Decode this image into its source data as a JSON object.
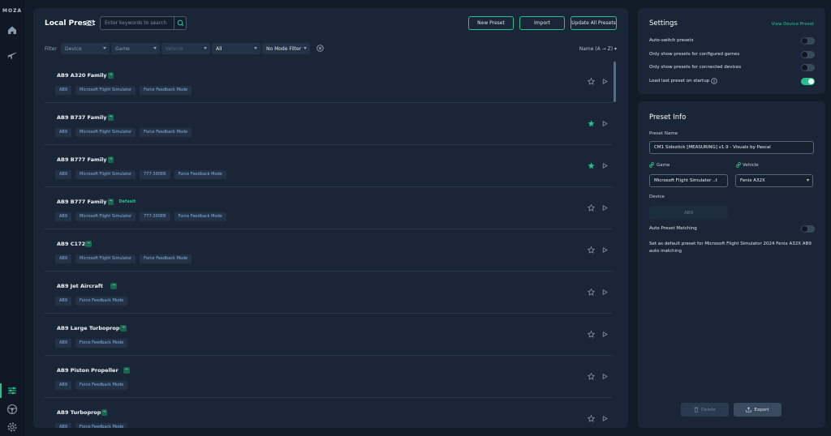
{
  "app": {
    "logo": "MOZA"
  },
  "local_preset": {
    "title": "Local Preset",
    "search_placeholder": "Enter keywords to search",
    "new_preset": "New Preset",
    "import": "Import",
    "update_all": "Update All Presets",
    "filter_label": "Filter",
    "filters": {
      "device": "Device",
      "game": "Game",
      "vehicle": "Vehicle",
      "all": "All",
      "mode": "No Mode Filter"
    },
    "sort": "Name (A → Z)",
    "rows": [
      {
        "name": "AB9 A320 Family",
        "version": "→",
        "default": "",
        "starred": false,
        "tags": [
          "AB9",
          "Microsoft Flight Simulator",
          "Force Feedback Mode"
        ]
      },
      {
        "name": "AB9 B737 Family",
        "version": "→",
        "default": "",
        "starred": true,
        "tags": [
          "AB9",
          "Microsoft Flight Simulator",
          "Force Feedback Mode"
        ]
      },
      {
        "name": "AB9 B777 Family",
        "version": "→",
        "default": "",
        "starred": true,
        "tags": [
          "AB9",
          "Microsoft Flight Simulator",
          "777-300ER",
          "Force Feedback Mode"
        ]
      },
      {
        "name": "AB9 B777 Family",
        "version": "→",
        "default": "Default",
        "starred": false,
        "tags": [
          "AB9",
          "Microsoft Flight Simulator",
          "777-300ER",
          "Force Feedback Mode"
        ]
      },
      {
        "name": "AB9 C172",
        "version": "→",
        "default": "",
        "starred": false,
        "tags": [
          "AB9",
          "Microsoft Flight Simulator",
          "Force Feedback Mode"
        ]
      },
      {
        "name": "AB9 Jet Aircraft",
        "version": "→",
        "default": "",
        "starred": false,
        "tags": [
          "AB9",
          "Force Feedback Mode"
        ]
      },
      {
        "name": "AB9 Large Turboprop",
        "version": "→",
        "default": "",
        "starred": false,
        "tags": [
          "AB9",
          "Force Feedback Mode"
        ]
      },
      {
        "name": "AB9 Piston Propeller",
        "version": "→",
        "default": "",
        "starred": false,
        "tags": [
          "AB9",
          "Force Feedback Mode"
        ]
      },
      {
        "name": "AB9 Turboprop",
        "version": "→",
        "default": "",
        "starred": false,
        "tags": [
          "AB9",
          "Force Feedback Mode"
        ]
      }
    ]
  },
  "settings": {
    "title": "Settings",
    "view_device_preset": "View Device Preset",
    "items": [
      {
        "label": "Auto-switch presets",
        "on": false
      },
      {
        "label": "Only show presets for configured games",
        "on": false
      },
      {
        "label": "Only show presets for connected devices",
        "on": false
      },
      {
        "label": "Load last preset on startup",
        "on": true
      }
    ]
  },
  "preset_info": {
    "title": "Preset Info",
    "name_label": "Preset Name",
    "name_value": "CM1 Sidestick [MEASURING] v1.9 - Visuals by Pascal",
    "game_label": "Game",
    "game_value": "Microsoft Flight Simulator ..t",
    "vehicle_label": "Vehicle",
    "vehicle_value": "Fenix A32X",
    "device_label": "Device",
    "device_value": "AB9",
    "auto_match_label": "Auto Preset Matching",
    "auto_match_on": false,
    "description": "Set as default preset for  Microsoft Flight Simulator 2024 Fenix A32X AB9 auto matching",
    "delete": "Delete",
    "export": "Export"
  },
  "colors": {
    "accent": "#27c08c",
    "panel": "#1a2638",
    "background": "#121b28"
  }
}
